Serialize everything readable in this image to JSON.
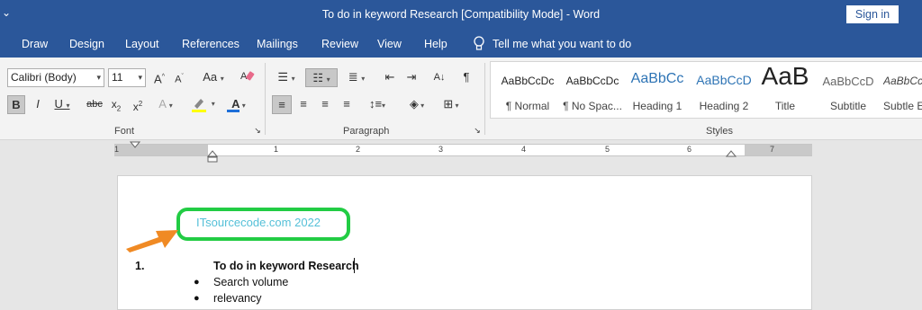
{
  "window": {
    "title": "To do in keyword Research [Compatibility Mode]  -  Word",
    "sign_in": "Sign in"
  },
  "tabs": [
    "Draw",
    "Design",
    "Layout",
    "References",
    "Mailings",
    "Review",
    "View",
    "Help"
  ],
  "tell_me": "Tell me what you want to do",
  "font_group": {
    "font_name": "Calibri (Body)",
    "font_size": "11",
    "label": "Font"
  },
  "paragraph_group": {
    "label": "Paragraph"
  },
  "styles_group": {
    "label": "Styles",
    "items": [
      {
        "sample": "AaBbCcDc",
        "name": "¶ Normal"
      },
      {
        "sample": "AaBbCcDc",
        "name": "¶ No Spac..."
      },
      {
        "sample": "AaBbCc",
        "name": "Heading 1"
      },
      {
        "sample": "AaBbCcD",
        "name": "Heading 2"
      },
      {
        "sample": "AaB",
        "name": "Title"
      },
      {
        "sample": "AaBbCcD",
        "name": "Subtitle"
      },
      {
        "sample": "AaBbCcD",
        "name": "Subtle E"
      }
    ]
  },
  "ruler": {
    "numbers": [
      "1",
      "1",
      "2",
      "3",
      "4",
      "5",
      "6",
      "7"
    ]
  },
  "document": {
    "watermark": "ITsourcecode.com 2022",
    "list_number": "1.",
    "heading": "To do in keyword Research",
    "bullets": [
      "Search volume",
      "relevancy"
    ]
  },
  "colors": {
    "title_bar": "#2b579a",
    "highlight_box": "#22cc44",
    "arrow": "#f08a24",
    "watermark_text": "#55c0d8"
  }
}
